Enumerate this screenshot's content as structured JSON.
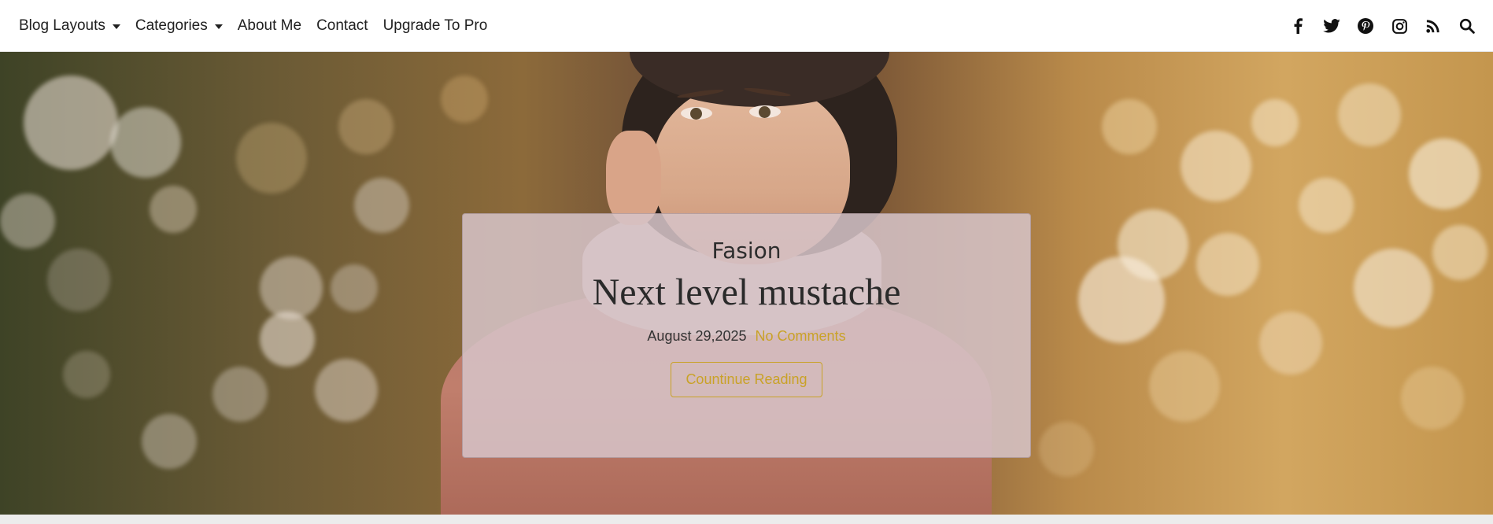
{
  "nav": {
    "items": [
      {
        "label": "Blog Layouts",
        "dropdown": true
      },
      {
        "label": "Categories",
        "dropdown": true
      },
      {
        "label": "About Me",
        "dropdown": false
      },
      {
        "label": "Contact",
        "dropdown": false
      },
      {
        "label": "Upgrade To Pro",
        "dropdown": false
      }
    ],
    "icons": [
      "facebook-icon",
      "twitter-icon",
      "pinterest-icon",
      "instagram-icon",
      "rss-icon",
      "search-icon"
    ]
  },
  "hero": {
    "category": "Fasion",
    "title": "Next level mustache",
    "date": "August 29,2025",
    "comments": "No Comments",
    "button_label": "Countinue Reading"
  },
  "colors": {
    "accent": "#c9a227",
    "text": "#212121",
    "card_bg": "#d6c4c8"
  }
}
